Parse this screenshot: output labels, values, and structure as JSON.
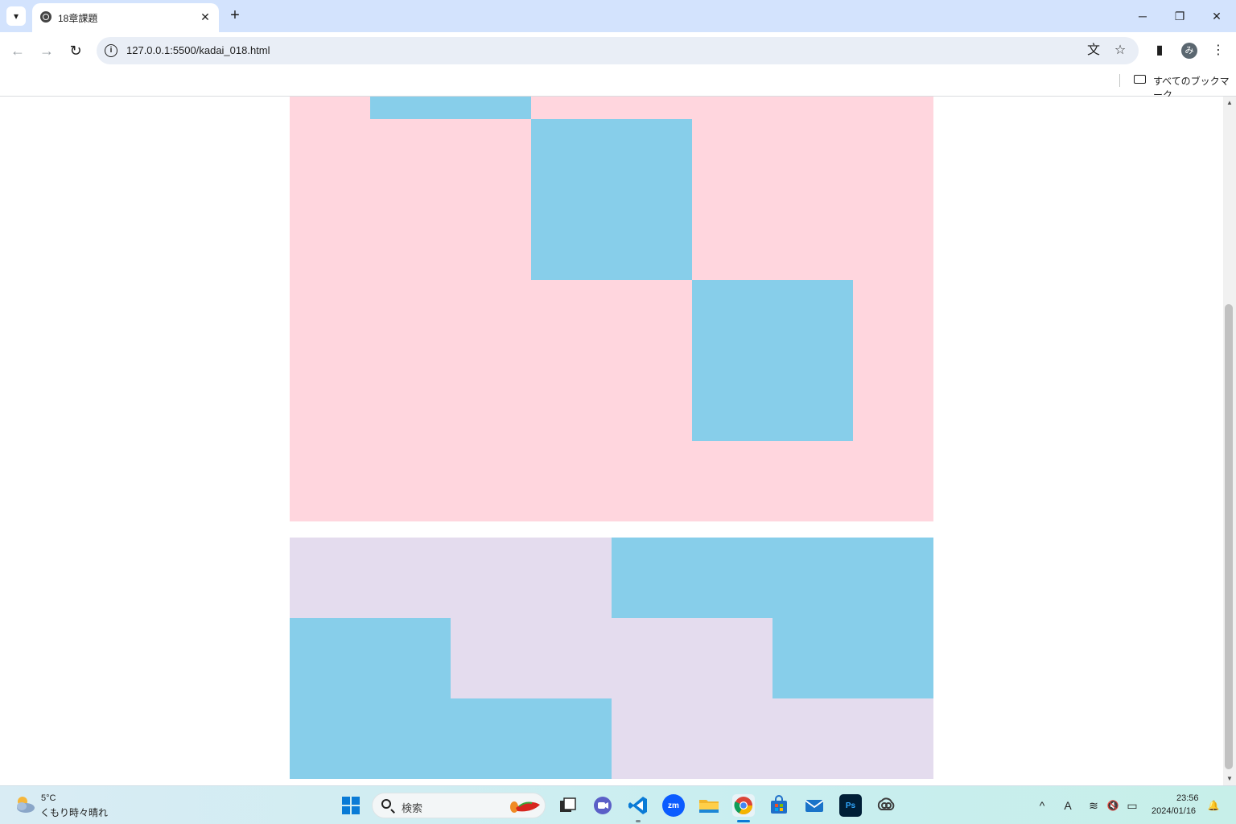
{
  "browser": {
    "tab_title": "18章課題",
    "new_tab_label": "+",
    "url": "127.0.0.1:5500/kadai_018.html",
    "bookmarks_label": "すべてのブックマーク",
    "profile_initial": "み",
    "icons": {
      "tab_search": "▾",
      "tab_close": "✕",
      "back": "←",
      "forward": "→",
      "reload": "↻",
      "site_info": "i",
      "translate": "文",
      "bookmark_star": "☆",
      "side_panel": "▮",
      "menu": "⋮",
      "minimize": "─",
      "restore": "❐",
      "close": "✕"
    }
  },
  "page": {
    "colors": {
      "pink": "#ffd6de",
      "lavender": "#e4dcee",
      "blue": "#87ceea"
    }
  },
  "taskbar": {
    "weather_temp": "5°C",
    "weather_desc": "くもり時々晴れ",
    "search_placeholder": "検索",
    "zoom_label": "zm",
    "photoshop_label": "Ps",
    "clock_time": "23:56",
    "clock_date": "2024/01/16",
    "tray": {
      "overflow": "^",
      "ime": "A",
      "wifi": "≋",
      "volume": "🔇",
      "battery": "▭",
      "notification": "🔔"
    }
  }
}
